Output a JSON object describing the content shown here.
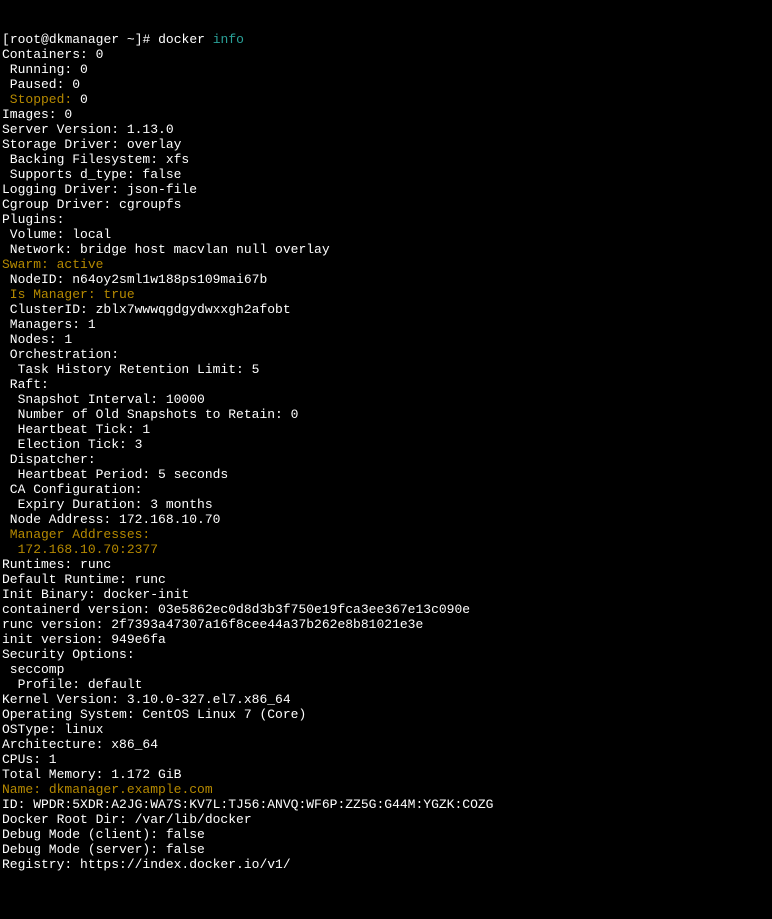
{
  "prompt": {
    "user": "root",
    "host": "dkmanager",
    "cwd": "~",
    "symbol": "#",
    "cmd1": "docker",
    "cmd2": "info"
  },
  "lines": {
    "containers": "Containers: 0",
    "running": " Running: 0",
    "paused": " Paused: 0",
    "stopped_label": " Stopped:",
    "stopped_val": " 0",
    "images": "Images: 0",
    "server_version": "Server Version: 1.13.0",
    "storage_driver": "Storage Driver: overlay",
    "backing_fs": " Backing Filesystem: xfs",
    "supports_dtype": " Supports d_type: false",
    "logging_driver": "Logging Driver: json-file",
    "cgroup_driver": "Cgroup Driver: cgroupfs",
    "plugins": "Plugins:",
    "volume": " Volume: local",
    "network": " Network: bridge host macvlan null overlay",
    "swarm_label": "Swarm:",
    "swarm_val": " active",
    "nodeid": " NodeID: n64oy2sml1w188ps109mai67b",
    "is_manager": " Is Manager: true",
    "clusterid": " ClusterID: zblx7wwwqgdgydwxxgh2afobt",
    "managers": " Managers: 1",
    "nodes": " Nodes: 1",
    "orchestration": " Orchestration:",
    "task_history": "  Task History Retention Limit: 5",
    "raft": " Raft:",
    "snapshot": "  Snapshot Interval: 10000",
    "old_snapshots": "  Number of Old Snapshots to Retain: 0",
    "heartbeat_tick": "  Heartbeat Tick: 1",
    "election_tick": "  Election Tick: 3",
    "dispatcher": " Dispatcher:",
    "heartbeat_period": "  Heartbeat Period: 5 seconds",
    "ca_config": " CA Configuration:",
    "expiry": "  Expiry Duration: 3 months",
    "node_address": " Node Address: 172.168.10.70",
    "manager_addresses": " Manager Addresses:",
    "manager_addr_val": "  172.168.10.70:2377",
    "runtimes": "Runtimes: runc",
    "default_runtime": "Default Runtime: runc",
    "init_binary": "Init Binary: docker-init",
    "containerd_version": "containerd version: 03e5862ec0d8d3b3f750e19fca3ee367e13c090e",
    "runc_version": "runc version: 2f7393a47307a16f8cee44a37b262e8b81021e3e",
    "init_version": "init version: 949e6fa",
    "security_options": "Security Options:",
    "seccomp": " seccomp",
    "profile": "  Profile: default",
    "kernel_version": "Kernel Version: 3.10.0-327.el7.x86_64",
    "operating_system": "Operating System: CentOS Linux 7 (Core)",
    "ostype": "OSType: linux",
    "architecture": "Architecture: x86_64",
    "cpus": "CPUs: 1",
    "total_memory": "Total Memory: 1.172 GiB",
    "name_label": "Name:",
    "name_val": " dkmanager.example.com",
    "id": "ID: WPDR:5XDR:A2JG:WA7S:KV7L:TJ56:ANVQ:WF6P:ZZ5G:G44M:YGZK:COZG",
    "docker_root": "Docker Root Dir: /var/lib/docker",
    "debug_client": "Debug Mode (client): false",
    "debug_server": "Debug Mode (server): false",
    "registry": "Registry: https://index.docker.io/v1/"
  }
}
